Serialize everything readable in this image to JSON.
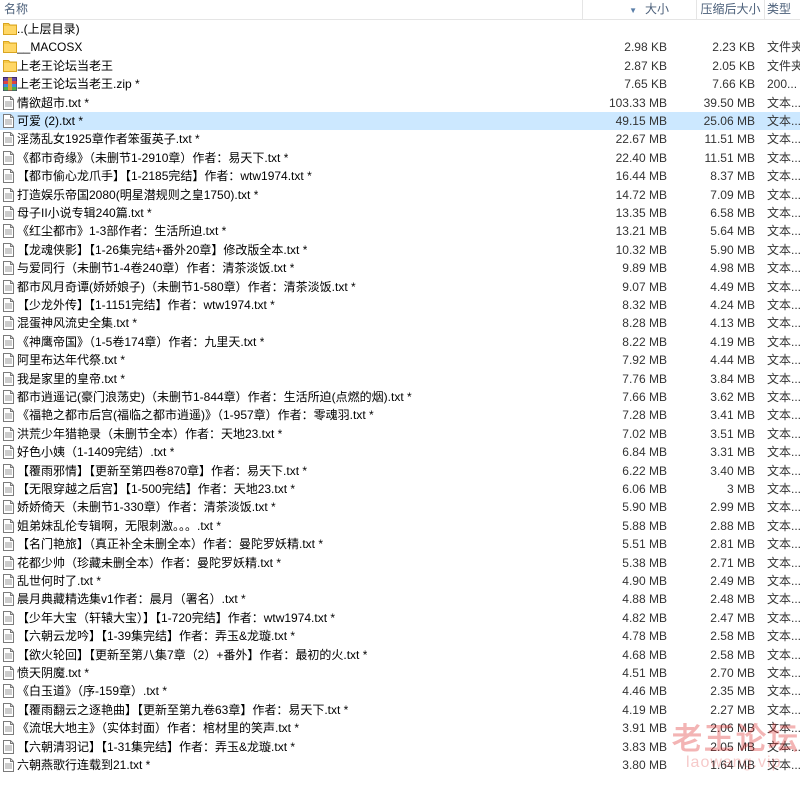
{
  "header": {
    "name": "名称",
    "size": "大小",
    "compressed": "压缩后大小",
    "type": "类型"
  },
  "watermark": {
    "main": "老王论坛",
    "sub": "laowang.vip"
  },
  "files": [
    {
      "icon": "folder-icon",
      "name": "..(上层目录)",
      "size": "",
      "compressed": "",
      "type": ""
    },
    {
      "icon": "folder-icon",
      "name": "__MACOSX",
      "size": "2.98 KB",
      "compressed": "2.23 KB",
      "type": "文件夹"
    },
    {
      "icon": "folder-icon",
      "name": "上老王论坛当老王",
      "size": "2.87 KB",
      "compressed": "2.05 KB",
      "type": "文件夹"
    },
    {
      "icon": "archive-icon",
      "name": "上老王论坛当老王.zip *",
      "size": "7.65 KB",
      "compressed": "7.66 KB",
      "type": "200..."
    },
    {
      "icon": "text-file-icon",
      "name": "情欲超市.txt *",
      "size": "103.33 MB",
      "compressed": "39.50 MB",
      "type": "文本..."
    },
    {
      "icon": "text-file-icon",
      "name": "可爱 (2).txt *",
      "size": "49.15 MB",
      "compressed": "25.06 MB",
      "type": "文本..."
    },
    {
      "icon": "text-file-icon",
      "name": "淫荡乱女1925章作者笨蛋英子.txt *",
      "size": "22.67 MB",
      "compressed": "11.51 MB",
      "type": "文本..."
    },
    {
      "icon": "text-file-icon",
      "name": "《都市奇缘》（未删节1-2910章）作者：易天下.txt *",
      "size": "22.40 MB",
      "compressed": "11.51 MB",
      "type": "文本..."
    },
    {
      "icon": "text-file-icon",
      "name": "【都市偷心龙爪手】【1-2185完结】作者：wtw1974.txt *",
      "size": "16.44 MB",
      "compressed": "8.37 MB",
      "type": "文本..."
    },
    {
      "icon": "text-file-icon",
      "name": "打造娱乐帝国2080(明星潜规则之皇1750).txt *",
      "size": "14.72 MB",
      "compressed": "7.09 MB",
      "type": "文本..."
    },
    {
      "icon": "text-file-icon",
      "name": "母子II小说专辑240篇.txt *",
      "size": "13.35 MB",
      "compressed": "6.58 MB",
      "type": "文本..."
    },
    {
      "icon": "text-file-icon",
      "name": "《红尘都市》1-3部作者：生活所迫.txt *",
      "size": "13.21 MB",
      "compressed": "5.64 MB",
      "type": "文本..."
    },
    {
      "icon": "text-file-icon",
      "name": "【龙魂侠影】【1-26集完结+番外20章】修改版全本.txt *",
      "size": "10.32 MB",
      "compressed": "5.90 MB",
      "type": "文本..."
    },
    {
      "icon": "text-file-icon",
      "name": "与爱同行（未删节1-4卷240章）作者：清茶淡饭.txt *",
      "size": "9.89 MB",
      "compressed": "4.98 MB",
      "type": "文本..."
    },
    {
      "icon": "text-file-icon",
      "name": "都市风月奇谭(娇娇娘子)（未删节1-580章）作者：清茶淡饭.txt *",
      "size": "9.07 MB",
      "compressed": "4.49 MB",
      "type": "文本..."
    },
    {
      "icon": "text-file-icon",
      "name": "【少龙外传】【1-1151完结】作者：wtw1974.txt *",
      "size": "8.32 MB",
      "compressed": "4.24 MB",
      "type": "文本..."
    },
    {
      "icon": "text-file-icon",
      "name": "混蛋神风流史全集.txt *",
      "size": "8.28 MB",
      "compressed": "4.13 MB",
      "type": "文本..."
    },
    {
      "icon": "text-file-icon",
      "name": "《神鹰帝国》（1-5卷174章）作者：九里天.txt *",
      "size": "8.22 MB",
      "compressed": "4.19 MB",
      "type": "文本..."
    },
    {
      "icon": "text-file-icon",
      "name": "阿里布达年代祭.txt *",
      "size": "7.92 MB",
      "compressed": "4.44 MB",
      "type": "文本..."
    },
    {
      "icon": "text-file-icon",
      "name": "我是家里的皇帝.txt *",
      "size": "7.76 MB",
      "compressed": "3.84 MB",
      "type": "文本..."
    },
    {
      "icon": "text-file-icon",
      "name": "都市逍遥记(豪门浪荡史)（未删节1-844章）作者：生活所迫(点燃的烟).txt *",
      "size": "7.66 MB",
      "compressed": "3.62 MB",
      "type": "文本..."
    },
    {
      "icon": "text-file-icon",
      "name": "《福艳之都市后宫(福临之都市逍遥)》（1-957章）作者：零魂羽.txt *",
      "size": "7.28 MB",
      "compressed": "3.41 MB",
      "type": "文本..."
    },
    {
      "icon": "text-file-icon",
      "name": "洪荒少年猎艳录（未删节全本）作者：天地23.txt *",
      "size": "7.02 MB",
      "compressed": "3.51 MB",
      "type": "文本..."
    },
    {
      "icon": "text-file-icon",
      "name": "好色小姨（1-1409完结）.txt *",
      "size": "6.84 MB",
      "compressed": "3.31 MB",
      "type": "文本..."
    },
    {
      "icon": "text-file-icon",
      "name": "【覆雨邪情】【更新至第四卷870章】作者：易天下.txt *",
      "size": "6.22 MB",
      "compressed": "3.40 MB",
      "type": "文本..."
    },
    {
      "icon": "text-file-icon",
      "name": "【无限穿越之后宫】【1-500完结】作者：天地23.txt *",
      "size": "6.06 MB",
      "compressed": "3 MB",
      "type": "文本..."
    },
    {
      "icon": "text-file-icon",
      "name": "娇娇倚天（未删节1-330章）作者：清茶淡饭.txt *",
      "size": "5.90 MB",
      "compressed": "2.99 MB",
      "type": "文本..."
    },
    {
      "icon": "text-file-icon",
      "name": "姐弟妹乱伦专辑啊，无限刺激。。。.txt *",
      "size": "5.88 MB",
      "compressed": "2.88 MB",
      "type": "文本..."
    },
    {
      "icon": "text-file-icon",
      "name": "【名门艳旅】（真正补全未删全本）作者：曼陀罗妖精.txt *",
      "size": "5.51 MB",
      "compressed": "2.81 MB",
      "type": "文本..."
    },
    {
      "icon": "text-file-icon",
      "name": "花都少帅（珍藏未删全本）作者：曼陀罗妖精.txt *",
      "size": "5.38 MB",
      "compressed": "2.71 MB",
      "type": "文本..."
    },
    {
      "icon": "text-file-icon",
      "name": "乱世何时了.txt *",
      "size": "4.90 MB",
      "compressed": "2.49 MB",
      "type": "文本..."
    },
    {
      "icon": "text-file-icon",
      "name": "晨月典藏精选集v1作者：晨月（署名）.txt *",
      "size": "4.88 MB",
      "compressed": "2.48 MB",
      "type": "文本..."
    },
    {
      "icon": "text-file-icon",
      "name": "【少年大宝（轩辕大宝）】【1-720完结】作者：wtw1974.txt *",
      "size": "4.82 MB",
      "compressed": "2.47 MB",
      "type": "文本..."
    },
    {
      "icon": "text-file-icon",
      "name": "【六朝云龙吟】【1-39集完结】作者：弄玉&龙璇.txt *",
      "size": "4.78 MB",
      "compressed": "2.58 MB",
      "type": "文本..."
    },
    {
      "icon": "text-file-icon",
      "name": "【欲火轮回】【更新至第八集7章（2）+番外】作者：最初的火.txt *",
      "size": "4.68 MB",
      "compressed": "2.58 MB",
      "type": "文本..."
    },
    {
      "icon": "text-file-icon",
      "name": "愤天阴魔.txt *",
      "size": "4.51 MB",
      "compressed": "2.70 MB",
      "type": "文本..."
    },
    {
      "icon": "text-file-icon",
      "name": "《白玉道》（序-159章）.txt *",
      "size": "4.46 MB",
      "compressed": "2.35 MB",
      "type": "文本..."
    },
    {
      "icon": "text-file-icon",
      "name": "【覆雨翻云之逐艳曲】【更新至第九卷63章】作者：易天下.txt *",
      "size": "4.19 MB",
      "compressed": "2.27 MB",
      "type": "文本..."
    },
    {
      "icon": "text-file-icon",
      "name": "《流氓大地主》（实体封面）作者：棺材里的笑声.txt *",
      "size": "3.91 MB",
      "compressed": "2.06 MB",
      "type": "文本..."
    },
    {
      "icon": "text-file-icon",
      "name": "【六朝清羽记】【1-31集完结】作者：弄玉&龙璇.txt *",
      "size": "3.83 MB",
      "compressed": "2.05 MB",
      "type": "文本..."
    },
    {
      "icon": "text-file-icon",
      "name": "六朝燕歌行连载到21.txt *",
      "size": "3.80 MB",
      "compressed": "1.64 MB",
      "type": "文本..."
    }
  ]
}
